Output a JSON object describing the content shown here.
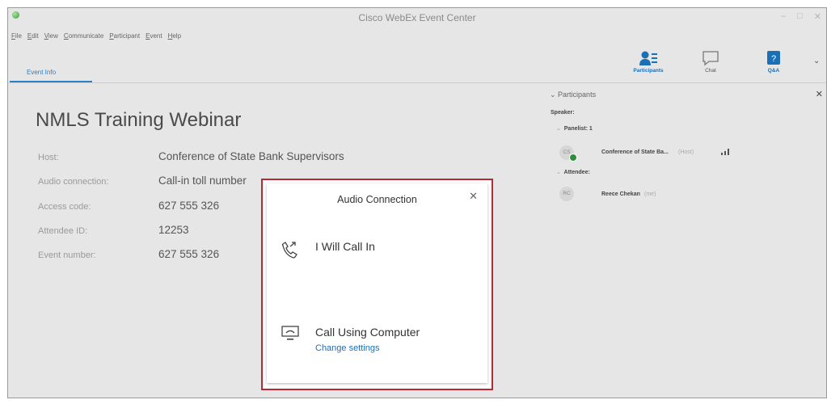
{
  "window": {
    "title": "Cisco WebEx Event Center",
    "menu": [
      "File",
      "Edit",
      "View",
      "Communicate",
      "Participant",
      "Event",
      "Help"
    ],
    "controls": [
      "–",
      "□",
      "✕"
    ]
  },
  "toolbar": {
    "participants_label": "Participants",
    "chat_label": "Chat",
    "qa_label": "Q&A",
    "more_glyph": "⌄"
  },
  "tabs": {
    "event_info": "Event Info"
  },
  "event": {
    "title": "NMLS Training Webinar",
    "rows": [
      {
        "label": "Host:",
        "value": "Conference of State Bank Supervisors"
      },
      {
        "label": "Audio connection:",
        "value": "Call-in toll number"
      },
      {
        "label": "Access code:",
        "value": "627 555 326"
      },
      {
        "label": "Attendee ID:",
        "value": "12253"
      },
      {
        "label": "Event number:",
        "value": "627 555 326"
      }
    ]
  },
  "participants": {
    "header": "⌄ Participants",
    "close": "✕",
    "speaker_label": "Speaker:",
    "panelist_group": "Panelist: 1",
    "attendee_group": "Attendee:",
    "panelist": {
      "initials": "CS",
      "name": "Conference of State Ba...",
      "tag": "(Host)"
    },
    "attendee": {
      "initials": "RC",
      "name": "Reece Chekan",
      "tag": "(me)"
    }
  },
  "dialog": {
    "title": "Audio Connection",
    "close": "✕",
    "option_call_in": "I Will Call In",
    "option_computer": "Call Using Computer",
    "change_settings": "Change settings"
  },
  "colors": {
    "accent": "#2b80c5",
    "highlight_border": "#b62a33",
    "presence_green": "#2f8d3e"
  }
}
